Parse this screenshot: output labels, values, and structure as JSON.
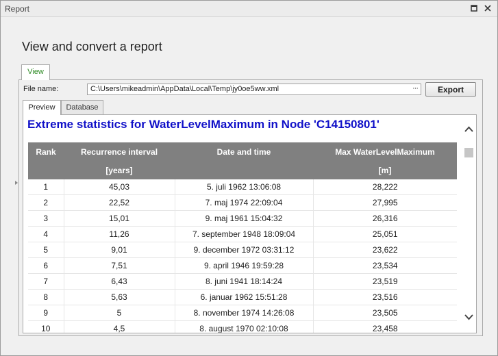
{
  "window": {
    "title": "Report"
  },
  "page": {
    "heading": "View and convert a report"
  },
  "outer_tabs": [
    {
      "label": "View"
    }
  ],
  "file": {
    "label": "File name:",
    "value": "C:\\Users\\mikeadmin\\AppData\\Local\\Temp\\jy0oe5ww.xml",
    "browse_label": "···"
  },
  "toolbar": {
    "export_label": "Export"
  },
  "inner_tabs": [
    {
      "label": "Preview"
    },
    {
      "label": "Database"
    }
  ],
  "report": {
    "title": "Extreme statistics for WaterLevelMaximum in Node 'C14150801'",
    "headers": {
      "rank": "Rank",
      "recurrence": "Recurrence interval",
      "recurrence_unit": "[years]",
      "datetime": "Date and time",
      "max": "Max WaterLevelMaximum",
      "max_unit": "[m]"
    },
    "rows": [
      {
        "rank": "1",
        "recurrence": "45,03",
        "datetime": "5. juli 1962 13:06:08",
        "max": "28,222"
      },
      {
        "rank": "2",
        "recurrence": "22,52",
        "datetime": "7. maj 1974 22:09:04",
        "max": "27,995"
      },
      {
        "rank": "3",
        "recurrence": "15,01",
        "datetime": "9. maj 1961 15:04:32",
        "max": "26,316"
      },
      {
        "rank": "4",
        "recurrence": "11,26",
        "datetime": "7. september 1948 18:09:04",
        "max": "25,051"
      },
      {
        "rank": "5",
        "recurrence": "9,01",
        "datetime": "9. december 1972 03:31:12",
        "max": "23,622"
      },
      {
        "rank": "6",
        "recurrence": "7,51",
        "datetime": "9. april 1946 19:59:28",
        "max": "23,534"
      },
      {
        "rank": "7",
        "recurrence": "6,43",
        "datetime": "8. juni 1941 18:14:24",
        "max": "23,519"
      },
      {
        "rank": "8",
        "recurrence": "5,63",
        "datetime": "6. januar 1962 15:51:28",
        "max": "23,516"
      },
      {
        "rank": "9",
        "recurrence": "5",
        "datetime": "8. november 1974 14:26:08",
        "max": "23,505"
      },
      {
        "rank": "10",
        "recurrence": "4,5",
        "datetime": "8. august 1970 02:10:08",
        "max": "23,458"
      }
    ]
  },
  "colors": {
    "title_blue": "#1010c8",
    "header_gray": "#808080",
    "tab_green": "#2e8b24"
  },
  "icons": {
    "restore": "restore-icon",
    "close": "close-icon",
    "scroll_up": "chevron-up-icon",
    "scroll_down": "chevron-down-icon"
  }
}
